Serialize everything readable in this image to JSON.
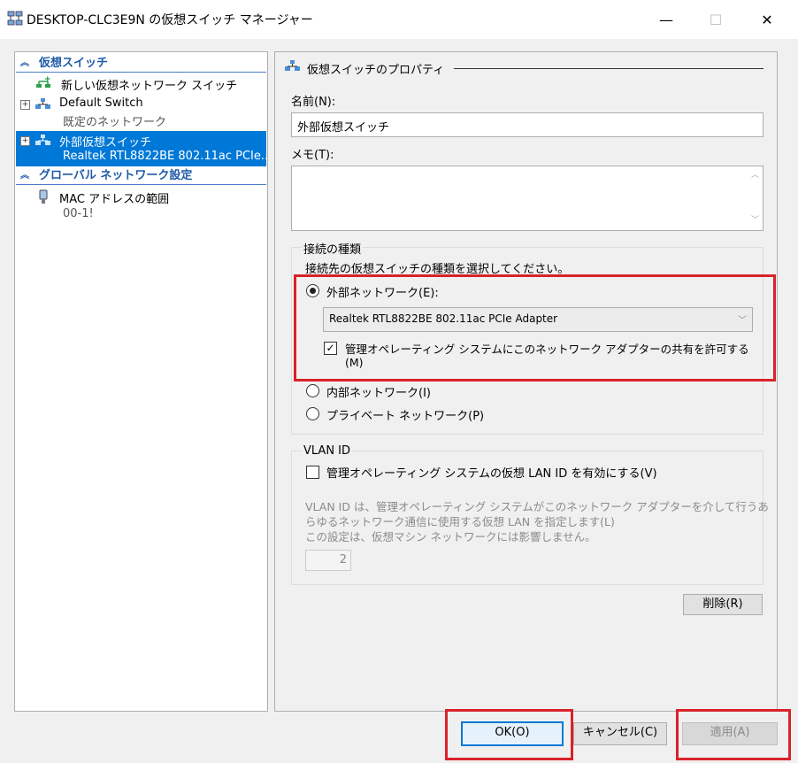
{
  "window": {
    "title": "DESKTOP-CLC3E9N の仮想スイッチ マネージャー",
    "minimize_glyph": "—",
    "maximize_glyph": "☐",
    "close_glyph": "✕"
  },
  "tree": {
    "section_switches": "仮想スイッチ",
    "new_switch": "新しい仮想ネットワーク スイッチ",
    "default_switch": "Default Switch",
    "default_switch_sub": "既定のネットワーク",
    "external_switch": "外部仮想スイッチ",
    "external_switch_sub": "Realtek RTL8822BE 802.11ac PCIe...",
    "section_global": "グローバル ネットワーク設定",
    "mac_range": "MAC アドレスの範囲",
    "mac_range_sub": "00-1!"
  },
  "props": {
    "header": "仮想スイッチのプロパティ",
    "name_label": "名前(N):",
    "name_value": "外部仮想スイッチ",
    "memo_label": "メモ(T):",
    "conn_group": "接続の種類",
    "conn_desc": "接続先の仮想スイッチの種類を選択してください。",
    "external_net": "外部ネットワーク(E):",
    "adapter": "Realtek RTL8822BE 802.11ac PCIe Adapter",
    "share_allow_line1": "管理オペレーティング システムにこのネットワーク アダプターの共有を許可する",
    "share_allow_line2": "(M)",
    "internal_net": "内部ネットワーク(I)",
    "private_net": "プライベート ネットワーク(P)",
    "vlan_group": "VLAN ID",
    "vlan_enable": "管理オペレーティング システムの仮想 LAN ID を有効にする(V)",
    "vlan_desc_1": "VLAN ID は、管理オペレーティング システムがこのネットワーク アダプターを介して行うあ",
    "vlan_desc_2": "らゆるネットワーク通信に使用する仮想 LAN を指定します(L)",
    "vlan_desc_3": "この設定は、仮想マシン ネットワークには影響しません。",
    "vlan_value": "2",
    "delete_btn": "削除(R)"
  },
  "footer": {
    "ok": "OK(O)",
    "cancel": "キャンセル(C)",
    "apply": "適用(A)"
  },
  "colors": {
    "selection": "#0078d7",
    "section_text": "#1e5aa8",
    "highlight_box": "#d9222a"
  }
}
